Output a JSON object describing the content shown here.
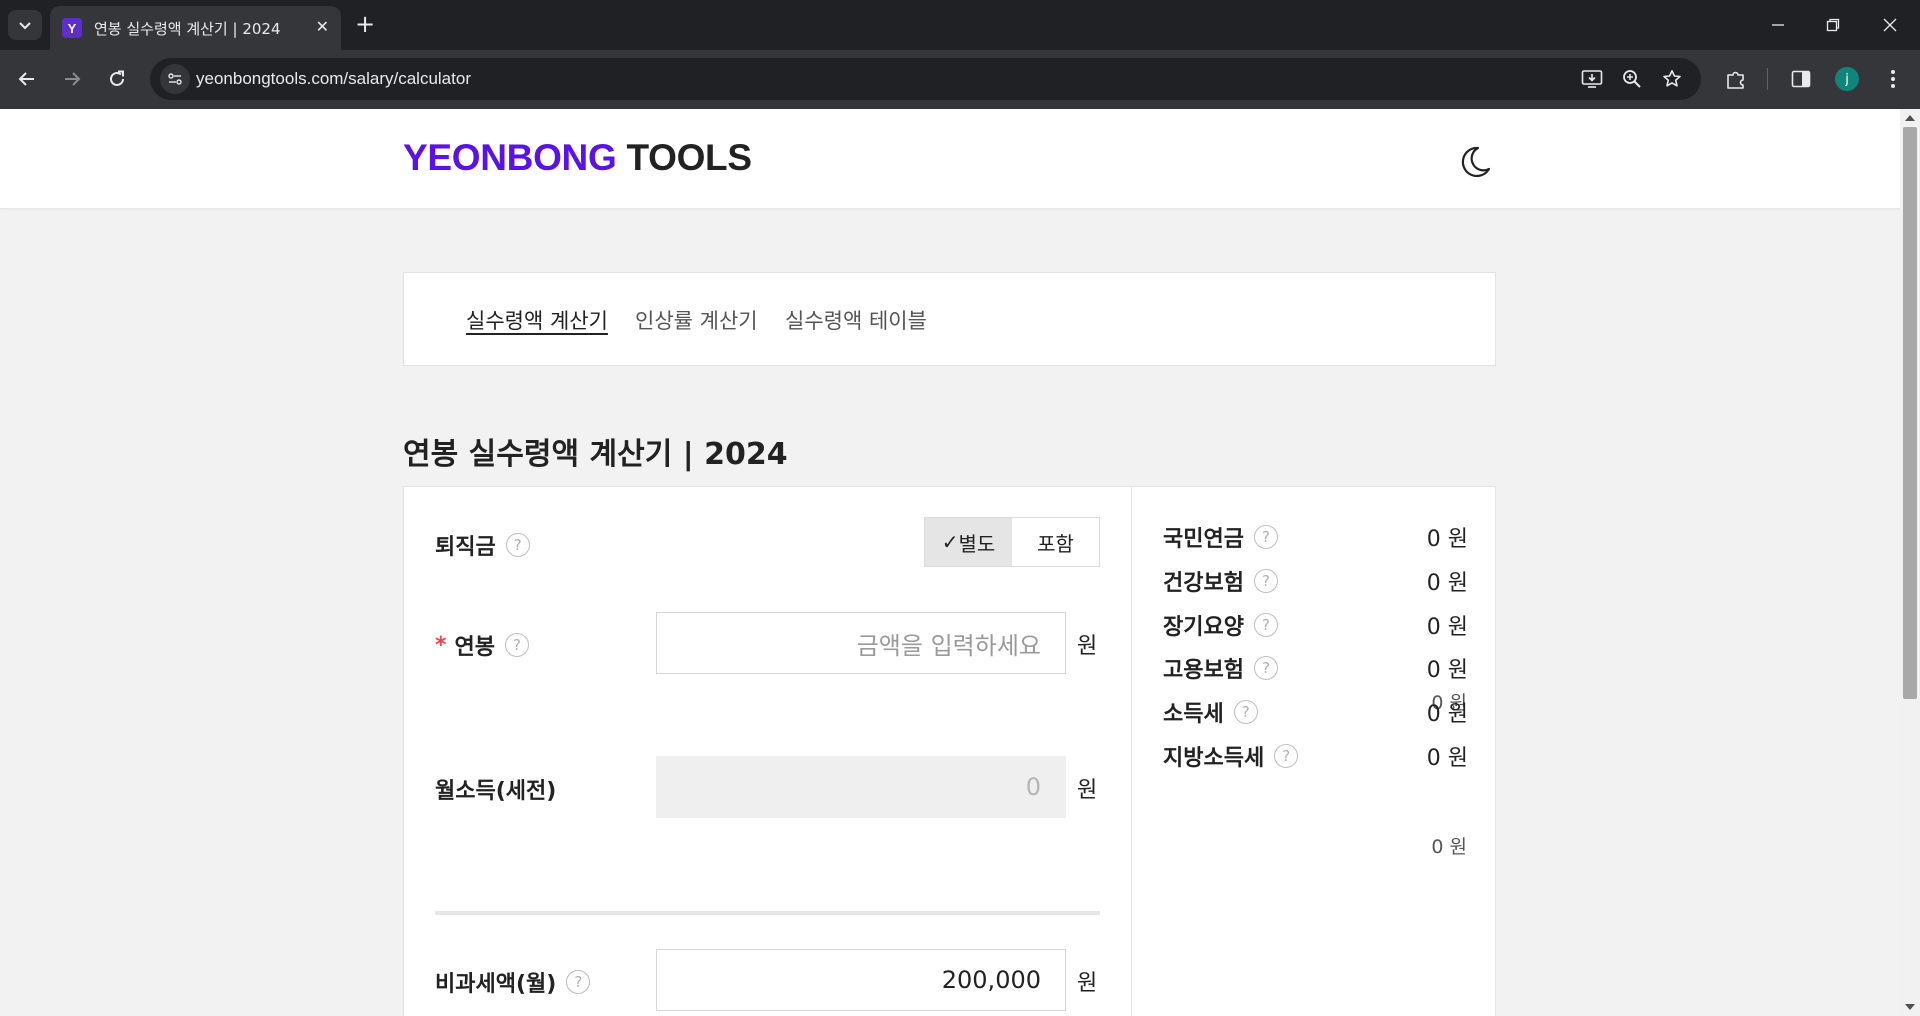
{
  "browser": {
    "tab_title": "연봉 실수령액 계산기 | 2024",
    "favicon_letter": "Y",
    "url": "yeonbongtools.com/salary/calculator",
    "profile_initial": "j"
  },
  "header": {
    "logo_brand": "YEONBONG",
    "logo_suffix": "TOOLS",
    "theme_icon": "moon-icon"
  },
  "subnav": {
    "items": [
      {
        "label": "실수령액 계산기",
        "active": true
      },
      {
        "label": "인상률 계산기",
        "active": false
      },
      {
        "label": "실수령액 테이블",
        "active": false
      }
    ]
  },
  "page_title": "연봉 실수령액 계산기 | 2024",
  "form": {
    "severance": {
      "label": "퇴직금",
      "options": [
        "별도",
        "포함"
      ],
      "selected_mark": "✓",
      "selected": "별도"
    },
    "salary": {
      "required_mark": "*",
      "label": "연봉",
      "placeholder": "금액을 입력하세요",
      "unit": "원",
      "amount_text": "0 원"
    },
    "monthly_income": {
      "label": "월소득(세전)",
      "value": "0",
      "unit": "원",
      "amount_text": "0 원"
    },
    "non_taxable": {
      "label": "비과세액(월)",
      "value": "200,000",
      "unit": "원"
    }
  },
  "deductions": [
    {
      "label": "국민연금",
      "value": "0 원"
    },
    {
      "label": "건강보험",
      "value": "0 원"
    },
    {
      "label": "장기요양",
      "value": "0 원"
    },
    {
      "label": "고용보험",
      "value": "0 원"
    },
    {
      "label": "소득세",
      "value": "0 원"
    },
    {
      "label": "지방소득세",
      "value": "0 원"
    }
  ],
  "colors": {
    "brand": "#5a12e6",
    "required": "#e5484d",
    "browser_dark": "#202124",
    "browser_toolbar": "#35363a"
  }
}
